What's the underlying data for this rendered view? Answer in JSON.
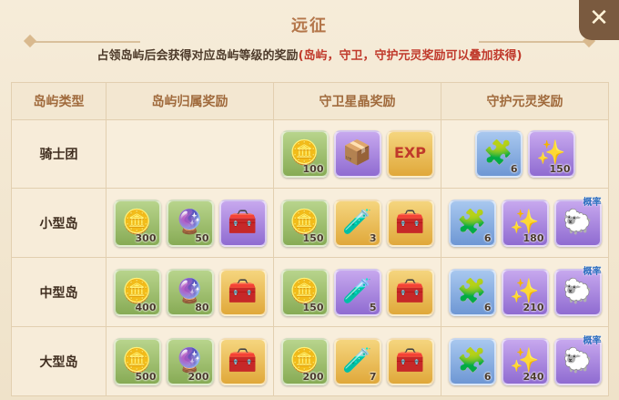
{
  "window": {
    "title": "远征",
    "close_glyph": "✕"
  },
  "description": {
    "prefix": "占领岛屿后会获得对应岛屿等级的奖励",
    "highlight": "(岛屿，守卫，守护元灵奖励可以叠加获得)"
  },
  "table": {
    "headers": [
      "岛屿类型",
      "岛屿归属奖励",
      "守卫星晶奖励",
      "守护元灵奖励"
    ],
    "rows": [
      {
        "label": "骑士团",
        "island": [],
        "guard": [
          {
            "icon": "gold-coin-icon",
            "glyph": "🪙",
            "quality": "q-green",
            "count": "100"
          },
          {
            "icon": "video-chest-icon",
            "glyph": "📦",
            "quality": "q-purple",
            "count": ""
          },
          {
            "icon": "exp-icon",
            "glyph": "EXP",
            "quality": "q-gold",
            "count": ""
          }
        ],
        "spirit": [
          {
            "icon": "puzzle-piece-icon",
            "glyph": "🧩",
            "quality": "q-blue",
            "count": "6",
            "prob": ""
          },
          {
            "icon": "magic-wand-icon",
            "glyph": "✨",
            "quality": "q-purple",
            "count": "150",
            "prob": ""
          }
        ]
      },
      {
        "label": "小型岛",
        "island": [
          {
            "icon": "gold-coin-icon",
            "glyph": "🪙",
            "quality": "q-green",
            "count": "300"
          },
          {
            "icon": "crystal-orb-icon",
            "glyph": "🔮",
            "quality": "q-green",
            "count": "50"
          },
          {
            "icon": "treasure-chest-icon",
            "glyph": "🧰",
            "quality": "q-purple",
            "count": ""
          }
        ],
        "guard": [
          {
            "icon": "gold-coin-icon",
            "glyph": "🪙",
            "quality": "q-green",
            "count": "150"
          },
          {
            "icon": "potion-bottle-icon",
            "glyph": "🧪",
            "quality": "q-gold",
            "count": "3"
          },
          {
            "icon": "treasure-chest-icon",
            "glyph": "🧰",
            "quality": "q-gold",
            "count": ""
          }
        ],
        "spirit": [
          {
            "icon": "puzzle-piece-icon",
            "glyph": "🧩",
            "quality": "q-blue",
            "count": "6",
            "prob": ""
          },
          {
            "icon": "magic-wand-icon",
            "glyph": "✨",
            "quality": "q-purple",
            "count": "180",
            "prob": ""
          },
          {
            "icon": "spirit-creature-icon",
            "glyph": "🐑",
            "quality": "q-purple",
            "count": "",
            "prob": "概率"
          }
        ]
      },
      {
        "label": "中型岛",
        "island": [
          {
            "icon": "gold-coin-icon",
            "glyph": "🪙",
            "quality": "q-green",
            "count": "400"
          },
          {
            "icon": "crystal-orb-icon",
            "glyph": "🔮",
            "quality": "q-green",
            "count": "80"
          },
          {
            "icon": "treasure-chest-icon",
            "glyph": "🧰",
            "quality": "q-gold",
            "count": ""
          }
        ],
        "guard": [
          {
            "icon": "gold-coin-icon",
            "glyph": "🪙",
            "quality": "q-green",
            "count": "150"
          },
          {
            "icon": "potion-bottle-icon",
            "glyph": "🧪",
            "quality": "q-purple",
            "count": "5"
          },
          {
            "icon": "treasure-chest-icon",
            "glyph": "🧰",
            "quality": "q-gold",
            "count": ""
          }
        ],
        "spirit": [
          {
            "icon": "puzzle-piece-icon",
            "glyph": "🧩",
            "quality": "q-blue",
            "count": "6",
            "prob": ""
          },
          {
            "icon": "magic-wand-icon",
            "glyph": "✨",
            "quality": "q-purple",
            "count": "210",
            "prob": ""
          },
          {
            "icon": "spirit-creature-icon",
            "glyph": "🐑",
            "quality": "q-purple",
            "count": "",
            "prob": "概率"
          }
        ]
      },
      {
        "label": "大型岛",
        "island": [
          {
            "icon": "gold-coin-icon",
            "glyph": "🪙",
            "quality": "q-green",
            "count": "500"
          },
          {
            "icon": "crystal-orb-icon",
            "glyph": "🔮",
            "quality": "q-green",
            "count": "200"
          },
          {
            "icon": "treasure-chest-icon",
            "glyph": "🧰",
            "quality": "q-gold",
            "count": ""
          }
        ],
        "guard": [
          {
            "icon": "gold-coin-icon",
            "glyph": "🪙",
            "quality": "q-green",
            "count": "200"
          },
          {
            "icon": "potion-bottle-icon",
            "glyph": "🧪",
            "quality": "q-gold",
            "count": "7"
          },
          {
            "icon": "treasure-chest-icon",
            "glyph": "🧰",
            "quality": "q-gold",
            "count": ""
          }
        ],
        "spirit": [
          {
            "icon": "puzzle-piece-icon",
            "glyph": "🧩",
            "quality": "q-blue",
            "count": "6",
            "prob": ""
          },
          {
            "icon": "magic-wand-icon",
            "glyph": "✨",
            "quality": "q-purple",
            "count": "240",
            "prob": ""
          },
          {
            "icon": "spirit-creature-icon",
            "glyph": "🐑",
            "quality": "q-purple",
            "count": "",
            "prob": "概率"
          }
        ]
      }
    ]
  },
  "colors": {
    "title": "#b4764a",
    "highlight": "#c0392b",
    "header_text": "#a06a3c",
    "probability_label": "#2f6fc0"
  }
}
